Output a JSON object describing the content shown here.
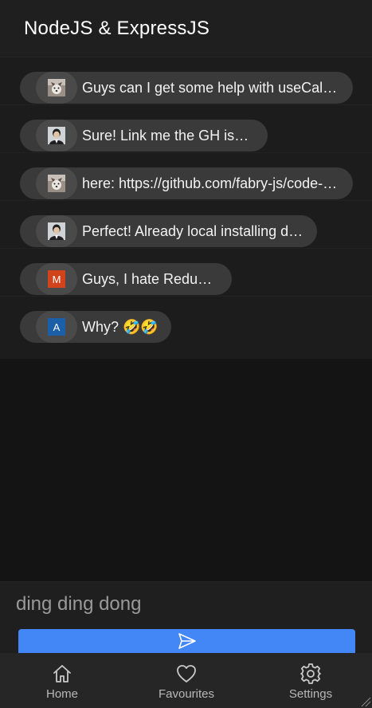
{
  "header": {
    "title": "NodeJS & ExpressJS"
  },
  "messages": [
    {
      "avatar": "husky-dog-photo",
      "text": "Guys can I get some help with useCallb…"
    },
    {
      "avatar": "person-photo",
      "text": "Sure! Link me the GH issue!"
    },
    {
      "avatar": "husky-dog-photo",
      "text": "here: https://github.com/fabry-js/code-p…"
    },
    {
      "avatar": "person-photo",
      "text": "Perfect! Already local installing deps"
    },
    {
      "avatar_letter": "M",
      "avatar_color": "#d0431b",
      "text": "Guys, I hate Redux😰"
    },
    {
      "avatar_letter": "A",
      "avatar_color": "#1a5fa8",
      "text": "Why? 🤣🤣"
    }
  ],
  "composer": {
    "value": "ding ding dong",
    "send_icon": "send-icon"
  },
  "tabs": [
    {
      "label": "Home",
      "icon": "home-icon"
    },
    {
      "label": "Favourites",
      "icon": "heart-icon"
    },
    {
      "label": "Settings",
      "icon": "gear-icon"
    }
  ],
  "colors": {
    "accent": "#4386f6",
    "bubble": "#3a3a3a",
    "background": "#141414"
  }
}
